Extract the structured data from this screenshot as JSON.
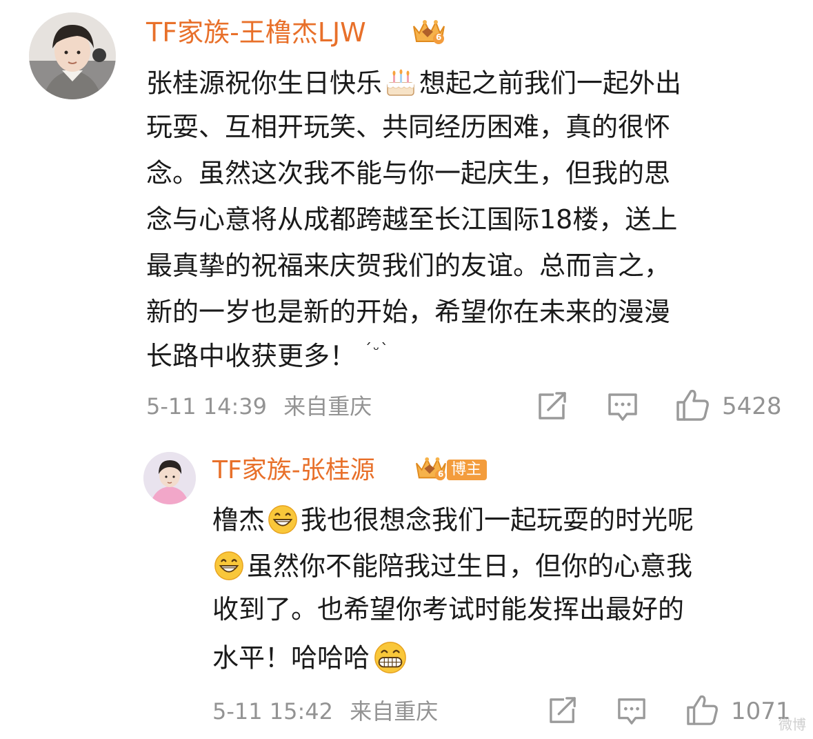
{
  "comment": {
    "username": "TF家族-王橹杰LJW",
    "badge_level": "6",
    "lines": [
      "张桂源祝你生日快乐",
      "想起之前我们一起外出",
      "玩耍、互相开玩笑、共同经历困难，真的很怀",
      "念。虽然这次我不能与你一起庆生，但我的思",
      "念与心意将从成都跨越至长江国际18楼，送上",
      "最真挚的祝福来庆贺我们的友谊。总而言之，",
      "新的一岁也是新的开始，希望你在未来的漫漫",
      "长路中收获更多！",
      "ˊᵕˋ"
    ],
    "time": "5-11 14:39",
    "location": "来自重庆",
    "likes": "5428"
  },
  "reply": {
    "username": "TF家族-张桂源",
    "badge_level": "6",
    "host_tag": "博主",
    "lines": [
      "橹杰",
      "我也很想念我们一起玩耍的时光呢",
      "虽然你不能陪我过生日，但你的心意我",
      "收到了。也希望你考试时能发挥出最好的",
      "水平！哈哈哈"
    ],
    "time": "5-11 15:42",
    "location": "来自重庆",
    "likes": "1071"
  },
  "watermark": "微博",
  "icons": {
    "share": "share-icon",
    "comment": "comment-icon",
    "like": "thumbs-up-icon",
    "crown": "crown-badge-icon",
    "cake": "birthday-cake-emoji",
    "grin": "grinning-face-emoji",
    "teeth": "grimacing-face-emoji"
  },
  "colors": {
    "username": "#e8702a",
    "text": "#1a1a1a",
    "meta": "#939393",
    "host_tag": "#f39c3c"
  }
}
